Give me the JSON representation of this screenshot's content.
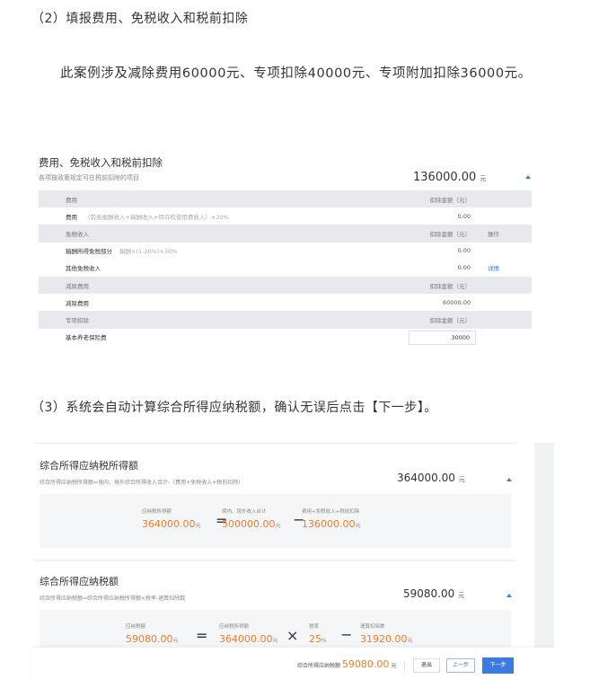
{
  "step2_heading": "（2）填报费用、免税收入和税前扣除",
  "step2_paragraph": "此案例涉及减除费用60000元、专项扣除40000元、专项附加扣除36000元。",
  "deduction_panel": {
    "title": "费用、免税收入和税前扣除",
    "subtitle": "各项按政策规定可在税前扣除的项目",
    "total": "136000.00",
    "unit": "元",
    "rows": [
      {
        "type": "header",
        "label": "费用",
        "amount": "扣除金额（元）",
        "op": ""
      },
      {
        "type": "item",
        "label": "费用",
        "hint": "（劳务报酬收入+稿酬收入+特许权使用费收入）×20%",
        "amount": "0.00",
        "op": ""
      },
      {
        "type": "header",
        "label": "免税收入",
        "amount": "扣除金额（元）",
        "op": "操作"
      },
      {
        "type": "item",
        "label": "稿酬所得免税部分",
        "hint": "稿酬×(1-20%)×30%",
        "amount": "0.00",
        "op": ""
      },
      {
        "type": "item",
        "label": "其他免税收入",
        "hint": "",
        "amount": "0.00",
        "op": "详情"
      },
      {
        "type": "header",
        "label": "减除费用",
        "amount": "扣除金额（元）",
        "op": ""
      },
      {
        "type": "item",
        "label": "减除费用",
        "hint": "",
        "amount": "60000.00",
        "op": ""
      },
      {
        "type": "header",
        "label": "专项扣除",
        "amount": "扣除金额（元）",
        "op": ""
      },
      {
        "type": "input",
        "label": "基本养老保险费",
        "hint": "",
        "amount": "30000",
        "op": ""
      }
    ]
  },
  "step3_heading": "（3）系统会自动计算综合所得应纳税额，确认无误后点击【下一步】。",
  "taxable_income": {
    "title": "综合所得应纳税所得额",
    "subtitle": "综合所得应纳税所得额=境内、境外综合所得收入合计-（费用+免税收入+税前扣除）",
    "total": "364000.00",
    "unit": "元",
    "f1_label": "应纳税所得额",
    "f1_value": "364000.00",
    "eq": "=",
    "f2_label": "境内、境外收入合计",
    "f2_value": "500000.00",
    "minus": "−",
    "f3_label": "费用+免税收入+税前扣除",
    "f3_value": "136000.00"
  },
  "tax_payable": {
    "title": "综合所得应纳税额",
    "subtitle": "综合所得应纳税额=综合所得应纳税所得额×税率-速算扣除数",
    "total": "59080.00",
    "unit": "元",
    "f1_label": "应纳税额",
    "f1_value": "59080.00",
    "eq": "=",
    "f2_label": "应纳税所得额",
    "f2_value": "364000.00",
    "times": "×",
    "f3_label": "税率",
    "f3_value": "25",
    "pct": "%",
    "minus": "−",
    "f4_label": "速算扣除数",
    "f4_value": "31920.00"
  },
  "footer": {
    "label": "综合所得应纳税额",
    "value": "59080.00",
    "unit": "元",
    "exit": "退出",
    "prev": "上一步",
    "next": "下一步"
  },
  "colors": {
    "accent": "#3b7be0",
    "orange": "#f07b2c"
  }
}
